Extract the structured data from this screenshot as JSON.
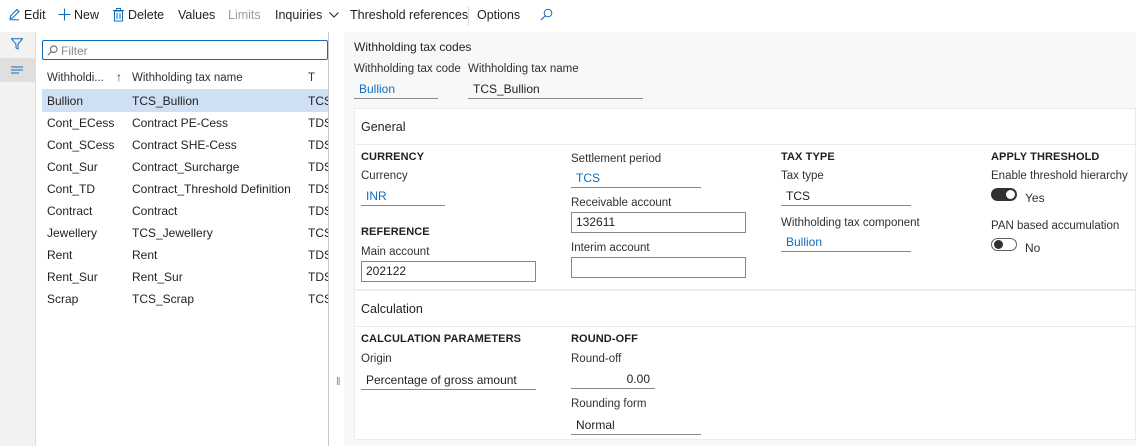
{
  "toolbar": {
    "edit": "Edit",
    "new": "New",
    "delete": "Delete",
    "values": "Values",
    "limits": "Limits",
    "inquiries": "Inquiries",
    "threshold_references": "Threshold references",
    "options": "Options"
  },
  "list": {
    "filter_placeholder": "Filter",
    "columns": [
      "Withholdi...",
      "Withholding tax name",
      "T"
    ],
    "rows": [
      {
        "code": "Bullion",
        "name": "TCS_Bullion",
        "type": "TCS"
      },
      {
        "code": "Cont_ECess",
        "name": "Contract PE-Cess",
        "type": "TDS"
      },
      {
        "code": "Cont_SCess",
        "name": "Contract SHE-Cess",
        "type": "TDS"
      },
      {
        "code": "Cont_Sur",
        "name": "Contract_Surcharge",
        "type": "TDS"
      },
      {
        "code": "Cont_TD",
        "name": "Contract_Threshold Definition",
        "type": "TDS"
      },
      {
        "code": "Contract",
        "name": "Contract",
        "type": "TDS"
      },
      {
        "code": "Jewellery",
        "name": "TCS_Jewellery",
        "type": "TCS"
      },
      {
        "code": "Rent",
        "name": "Rent",
        "type": "TDS"
      },
      {
        "code": "Rent_Sur",
        "name": "Rent_Sur",
        "type": "TDS"
      },
      {
        "code": "Scrap",
        "name": "TCS_Scrap",
        "type": "TCS"
      }
    ]
  },
  "header": {
    "title": "Withholding tax codes",
    "code_label": "Withholding tax code",
    "code_value": "Bullion",
    "name_label": "Withholding tax name",
    "name_value": "TCS_Bullion"
  },
  "general": {
    "title": "General",
    "currency_group": "CURRENCY",
    "currency_label": "Currency",
    "currency_value": "INR",
    "reference_group": "REFERENCE",
    "main_account_label": "Main account",
    "main_account_value": "202122",
    "settlement_label": "Settlement period",
    "settlement_value": "TCS",
    "receivable_label": "Receivable account",
    "receivable_value": "132611",
    "interim_label": "Interim account",
    "interim_value": "",
    "taxtype_group": "TAX TYPE",
    "taxtype_label": "Tax type",
    "taxtype_value": "TCS",
    "component_label": "Withholding tax component",
    "component_value": "Bullion",
    "threshold_group": "APPLY THRESHOLD",
    "hierarchy_label": "Enable threshold hierarchy",
    "hierarchy_value": "Yes",
    "hierarchy_on": true,
    "pan_label": "PAN based accumulation",
    "pan_value": "No",
    "pan_on": false
  },
  "calculation": {
    "title": "Calculation",
    "params_group": "CALCULATION PARAMETERS",
    "origin_label": "Origin",
    "origin_value": "Percentage of gross amount",
    "roundoff_group": "ROUND-OFF",
    "roundoff_label": "Round-off",
    "roundoff_value": "0.00",
    "rounding_form_label": "Rounding form",
    "rounding_form_value": "Normal"
  },
  "colors": {
    "accent": "#0f6cbd",
    "selected_row": "#cfe0f5"
  }
}
